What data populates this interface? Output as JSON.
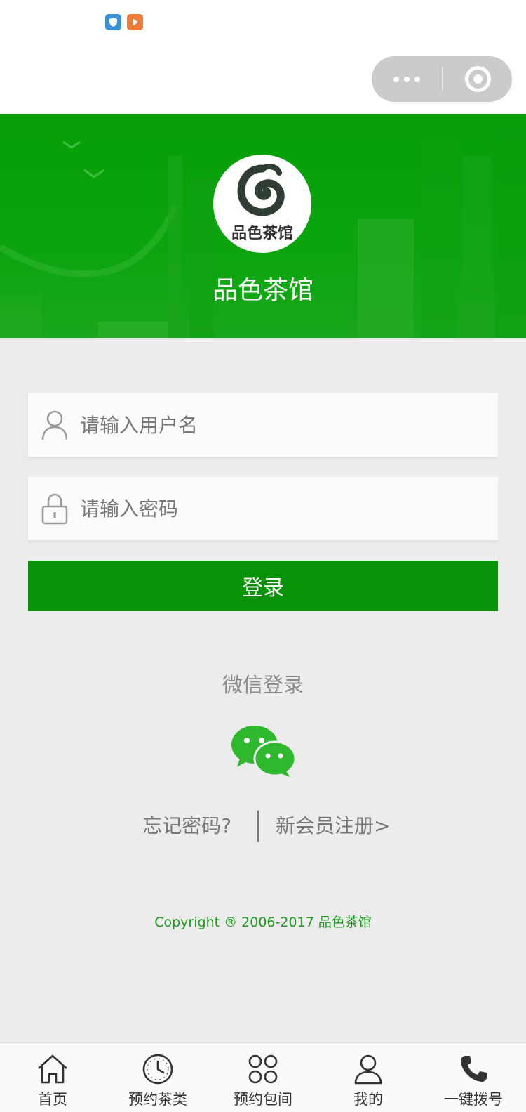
{
  "brand": {
    "name": "品色茶馆",
    "logo_text": "品色茶馆",
    "color": "#0a9a0a"
  },
  "form": {
    "username_placeholder": "请输入用户名",
    "password_placeholder": "请输入密码",
    "login_label": "登录"
  },
  "wechat": {
    "title": "微信登录",
    "icon": "wechat-icon"
  },
  "links": {
    "forgot": "忘记密码?",
    "register": "新会员注册>"
  },
  "footer": {
    "copyright": "Copyright ® 2006-2017 品色茶馆"
  },
  "tabbar": {
    "items": [
      {
        "label": "首页",
        "icon": "home-icon"
      },
      {
        "label": "预约茶类",
        "icon": "clock-icon"
      },
      {
        "label": "预约包间",
        "icon": "grid-icon"
      },
      {
        "label": "我的",
        "icon": "person-icon"
      },
      {
        "label": "一键拨号",
        "icon": "phone-icon"
      }
    ]
  }
}
